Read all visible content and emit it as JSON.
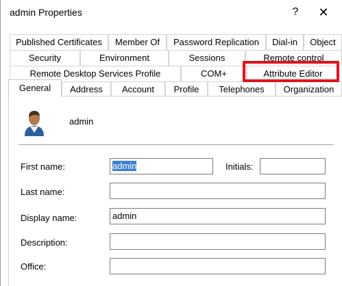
{
  "window": {
    "title": "admin Properties",
    "help_label": "?",
    "close_label": "✕"
  },
  "tabs": {
    "row1": [
      "Published Certificates",
      "Member Of",
      "Password Replication",
      "Dial-in",
      "Object"
    ],
    "row2": [
      "Security",
      "Environment",
      "Sessions",
      "Remote control"
    ],
    "row3": [
      "Remote Desktop Services Profile",
      "COM+",
      "Attribute Editor"
    ],
    "row4": [
      "General",
      "Address",
      "Account",
      "Profile",
      "Telephones",
      "Organization"
    ],
    "selected": "General",
    "highlighted": "Attribute Editor",
    "highlight_color": "#e0141e"
  },
  "general": {
    "user_icon": "user-icon",
    "user_name": "admin",
    "first_name_label": "First name:",
    "first_name_value": "admin",
    "initials_label": "Initials:",
    "initials_value": "",
    "last_name_label": "Last name:",
    "last_name_value": "",
    "display_name_label": "Display name:",
    "display_name_value": "admin",
    "description_label": "Description:",
    "description_value": "",
    "office_label": "Office:",
    "office_value": ""
  },
  "colors": {
    "selection": "#3d7fd1"
  }
}
